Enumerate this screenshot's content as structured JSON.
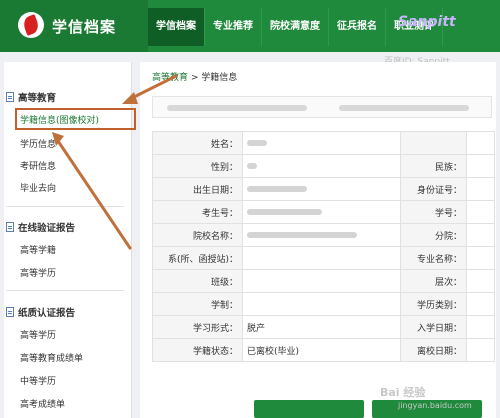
{
  "header": {
    "site_title": "学信档案",
    "nav": [
      "学信档案",
      "专业推荐",
      "院校满意度",
      "征兵报名",
      "职业测评"
    ],
    "watermark_id": "百度ID: Sanpitt"
  },
  "sidebar": {
    "groups": [
      {
        "title": "高等教育",
        "items": [
          "学籍信息(图像校对)",
          "学历信息",
          "考研信息",
          "毕业去向"
        ]
      },
      {
        "title": "在线验证报告",
        "items": [
          "高等学籍",
          "高等学历"
        ]
      },
      {
        "title": "纸质认证报告",
        "items": [
          "高等学历",
          "高等教育成绩单",
          "中等学历",
          "高考成绩单"
        ]
      }
    ]
  },
  "breadcrumb": {
    "home": "高等教育",
    "separator": " > ",
    "current": "学籍信息"
  },
  "table": {
    "rows": [
      {
        "l1": "姓名：",
        "v1": "",
        "l2": "",
        "v2": ""
      },
      {
        "l1": "性别：",
        "v1": "",
        "l2": "民族：",
        "v2": ""
      },
      {
        "l1": "出生日期：",
        "v1": "",
        "l2": "身份证号：",
        "v2": ""
      },
      {
        "l1": "考生号：",
        "v1": "",
        "l2": "学号：",
        "v2": ""
      },
      {
        "l1": "院校名称：",
        "v1": "",
        "l2": "分院：",
        "v2": ""
      },
      {
        "l1": "系(所、函授站)：",
        "v1": "",
        "l2": "专业名称：",
        "v2": ""
      },
      {
        "l1": "班级：",
        "v1": "",
        "l2": "层次：",
        "v2": ""
      },
      {
        "l1": "学制：",
        "v1": "",
        "l2": "学历类别：",
        "v2": ""
      },
      {
        "l1": "学习形式：",
        "v1": "脱产",
        "l2": "入学日期：",
        "v2": ""
      },
      {
        "l1": "学籍状态：",
        "v1": "已离校(毕业)",
        "l2": "离校日期：",
        "v2": ""
      }
    ]
  },
  "footer": {
    "baidu_mark": "Bai 经验",
    "baidu_url": "jingyan.baidu.com"
  },
  "colors": {
    "brand_green": "#1f8a3b",
    "annotation": "#c0602a"
  }
}
